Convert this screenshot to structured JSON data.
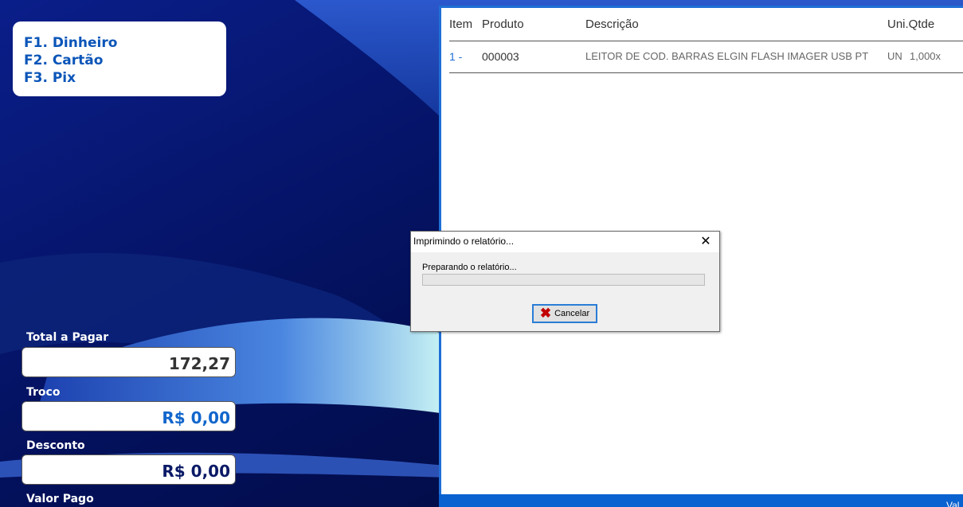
{
  "shortcuts": {
    "items": [
      "F1. Dinheiro",
      "F2. Cartão",
      "F3. Pix"
    ]
  },
  "totals": {
    "total_label": "Total a Pagar",
    "total_value": "172,27",
    "troco_label": "Troco",
    "troco_value": "R$ 0,00",
    "desconto_label": "Desconto",
    "desconto_value": "R$ 0,00",
    "valor_pago_label": "Valor Pago"
  },
  "item_list": {
    "columns": [
      "Item",
      "Produto",
      "Descrição",
      "Uni.Qtde"
    ],
    "rows": [
      {
        "item": "1 -",
        "produto": "000003",
        "descricao": "LEITOR DE COD. BARRAS ELGIN FLASH IMAGER USB PT",
        "uni": "UN",
        "qtde": "1,000x"
      }
    ],
    "footer_text": "Val"
  },
  "dialog": {
    "title": "Imprimindo o relatório...",
    "status": "Preparando o relatório...",
    "progress": 0,
    "cancel_label": "Cancelar"
  },
  "colors": {
    "accent_blue": "#0a55b8",
    "dark_navy": "#0a1a66",
    "panel_border": "#1f6fd6",
    "cancel_icon": "#c20000"
  },
  "icons": {
    "close": "close-icon",
    "cancel": "cancel-x-icon"
  }
}
